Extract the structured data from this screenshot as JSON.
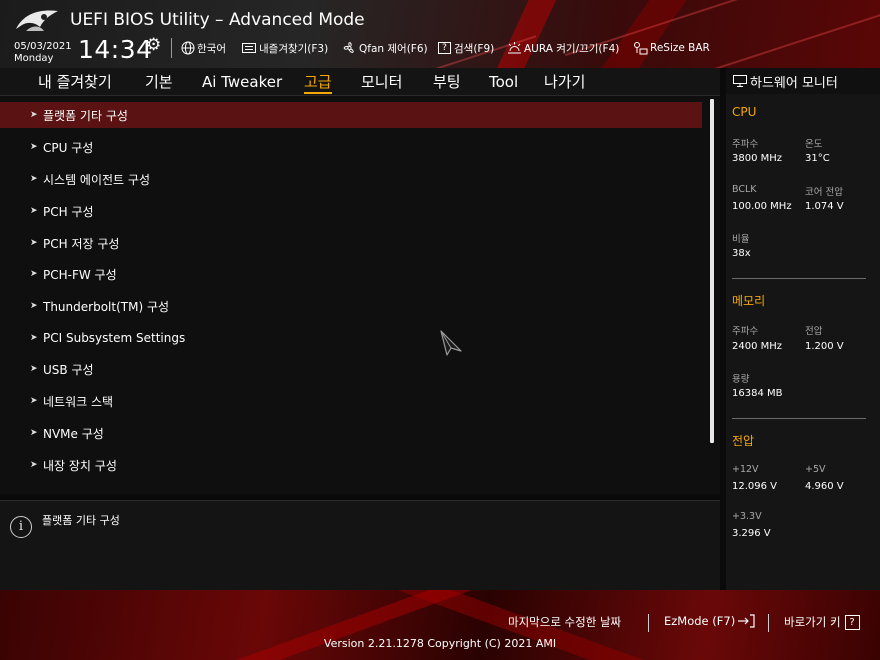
{
  "header": {
    "title": "UEFI BIOS Utility – Advanced Mode",
    "date": "05/03/2021",
    "day": "Monday",
    "time": "14:34",
    "items": [
      {
        "icon": "globe-icon",
        "label": "한국어"
      },
      {
        "icon": "favorites-icon",
        "label": "내즐겨찾기(F3)"
      },
      {
        "icon": "fan-icon",
        "label": "Qfan 제어(F6)"
      },
      {
        "icon": "question-icon",
        "label": "검색(F9)"
      },
      {
        "icon": "aura-icon",
        "label": "AURA 켜기/끄기(F4)"
      },
      {
        "icon": "resize-bar-icon",
        "label": "ReSize BAR"
      }
    ]
  },
  "tabs": [
    {
      "label": "내 즐겨찾기"
    },
    {
      "label": "기본"
    },
    {
      "label": "Ai Tweaker"
    },
    {
      "label": "고급",
      "active": true
    },
    {
      "label": "모니터"
    },
    {
      "label": "부팅"
    },
    {
      "label": "Tool"
    },
    {
      "label": "나가기"
    }
  ],
  "menu": [
    {
      "label": "플랫폼 기타 구성",
      "selected": true
    },
    {
      "label": "CPU 구성"
    },
    {
      "label": "시스템 에이전트 구성"
    },
    {
      "label": "PCH 구성"
    },
    {
      "label": "PCH 저장 구성"
    },
    {
      "label": "PCH-FW 구성"
    },
    {
      "label": "Thunderbolt(TM) 구성"
    },
    {
      "label": "PCI Subsystem Settings"
    },
    {
      "label": "USB 구성"
    },
    {
      "label": "네트워크 스택"
    },
    {
      "label": "NVMe 구성"
    },
    {
      "label": "내장 장치 구성"
    }
  ],
  "help": {
    "text": "플랫폼 기타 구성"
  },
  "hw_monitor": {
    "title": "하드웨어 모니터",
    "cpu": {
      "section": "CPU",
      "freq_label": "주파수",
      "freq_value": "3800 MHz",
      "temp_label": "온도",
      "temp_value": "31°C",
      "bclk_label": "BCLK",
      "bclk_value": "100.00 MHz",
      "core_v_label": "코어 전압",
      "core_v_value": "1.074 V",
      "ratio_label": "비율",
      "ratio_value": "38x"
    },
    "memory": {
      "section": "메모리",
      "freq_label": "주파수",
      "freq_value": "2400 MHz",
      "volt_label": "전압",
      "volt_value": "1.200 V",
      "cap_label": "용량",
      "cap_value": "16384 MB"
    },
    "voltage": {
      "section": "전압",
      "v12_label": "+12V",
      "v12_value": "12.096 V",
      "v5_label": "+5V",
      "v5_value": "4.960 V",
      "v33_label": "+3.3V",
      "v33_value": "3.296 V"
    }
  },
  "footer": {
    "last_modified": "마지막으로 수정한 날짜",
    "ezmode": "EzMode (F7)",
    "hotkeys": "바로가기 키",
    "hotkeys_box": "?",
    "version": "Version 2.21.1278 Copyright (C) 2021 AMI"
  },
  "colors": {
    "accent": "#f5a800",
    "selected_row": "#5a1212"
  }
}
